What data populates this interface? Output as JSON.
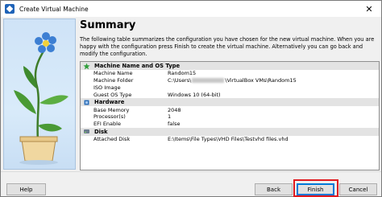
{
  "window": {
    "title": "Create Virtual Machine",
    "close_glyph": "✕"
  },
  "page": {
    "heading": "Summary",
    "description": "The following table summarizes the configuration you have chosen for the new virtual machine. When you are happy with the configuration press Finish to create the virtual machine. Alternatively you can go back and modify the configuration."
  },
  "sections": [
    {
      "title": "Machine Name and OS Type",
      "icon": "green-star-icon",
      "rows": [
        {
          "key": "Machine Name",
          "value": "Random15"
        },
        {
          "key": "Machine Folder",
          "value_prefix": "C:\\Users\\",
          "value_suffix": "\\VirtualBox VMs\\Random15"
        },
        {
          "key": "ISO Image",
          "value": ""
        },
        {
          "key": "Guest OS Type",
          "value": "Windows 10 (64-bit)"
        }
      ]
    },
    {
      "title": "Hardware",
      "icon": "chip-icon",
      "rows": [
        {
          "key": "Base Memory",
          "value": "2048"
        },
        {
          "key": "Processor(s)",
          "value": "1"
        },
        {
          "key": "EFI Enable",
          "value": "false"
        }
      ]
    },
    {
      "title": "Disk",
      "icon": "hard-disk-icon",
      "rows": [
        {
          "key": "Attached Disk",
          "value": "E:\\Items\\File Types\\VHD Files\\Testvhd files.vhd"
        }
      ]
    }
  ],
  "buttons": {
    "help": "Help",
    "back": "Back",
    "finish": "Finish",
    "cancel": "Cancel"
  },
  "colors": {
    "highlight": "#e0191f",
    "default_button_border": "#0078d7"
  }
}
